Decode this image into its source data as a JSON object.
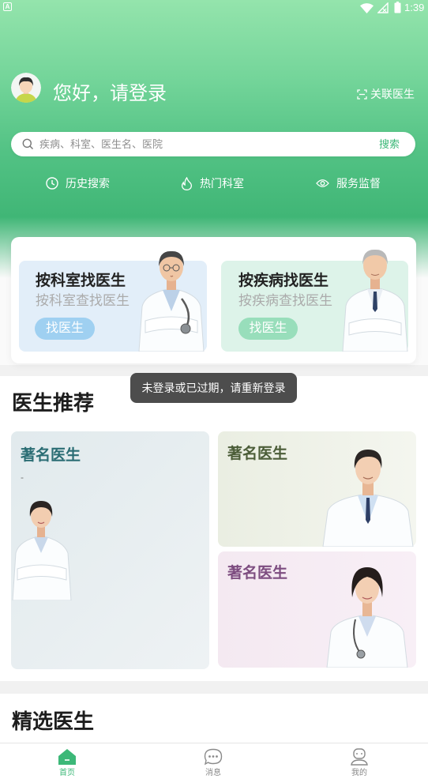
{
  "status_bar": {
    "notification_badge": "A",
    "time": "1:39",
    "icons": [
      "wifi-icon",
      "no-sim-signal-icon",
      "battery-icon"
    ]
  },
  "header": {
    "avatar_icon": "avatar-icon",
    "greeting": "您好，请登录",
    "link_doctor_icon": "scan-icon",
    "link_doctor_label": "关联医生"
  },
  "search": {
    "icon": "search-icon",
    "placeholder": "疾病、科室、医生名、医院",
    "button_label": "搜索"
  },
  "quick_links": [
    {
      "label": "历史搜索",
      "icon": "clock-icon"
    },
    {
      "label": "热门科室",
      "icon": "fire-icon"
    },
    {
      "label": "服务监督",
      "icon": "eye-icon"
    }
  ],
  "find_doctor": [
    {
      "title": "按科室找医生",
      "subtitle": "按科室查找医生",
      "button_label": "找医生"
    },
    {
      "title": "按疾病找医生",
      "subtitle": "按疾病查找医生",
      "button_label": "找医生"
    }
  ],
  "toast": {
    "message": "未登录或已过期，请重新登录"
  },
  "recommended": {
    "heading": "医生推荐",
    "cards": [
      {
        "title": "著名医生",
        "subtitle": "-"
      },
      {
        "title": "著名医生"
      },
      {
        "title": "著名医生"
      }
    ]
  },
  "featured": {
    "heading": "精选医生"
  },
  "tab_bar": [
    {
      "label": "首页",
      "icon": "home-icon",
      "active": true
    },
    {
      "label": "消息",
      "icon": "message-icon",
      "active": false
    },
    {
      "label": "我的",
      "icon": "profile-icon",
      "active": false
    }
  ],
  "colors": {
    "brand_green": "#3cb878",
    "header_top": "#94e4ac",
    "header_bottom": "#40b676",
    "dept_card_bg": "#e2eef9",
    "disease_card_bg": "#ddf3e9",
    "dept_button": "#9fd0f1",
    "disease_button": "#98debb",
    "card1_title": "#2b6d74",
    "card2_title": "#4b5d38",
    "card3_title": "#7d4d80",
    "tab_inactive": "#8a8a8a"
  }
}
